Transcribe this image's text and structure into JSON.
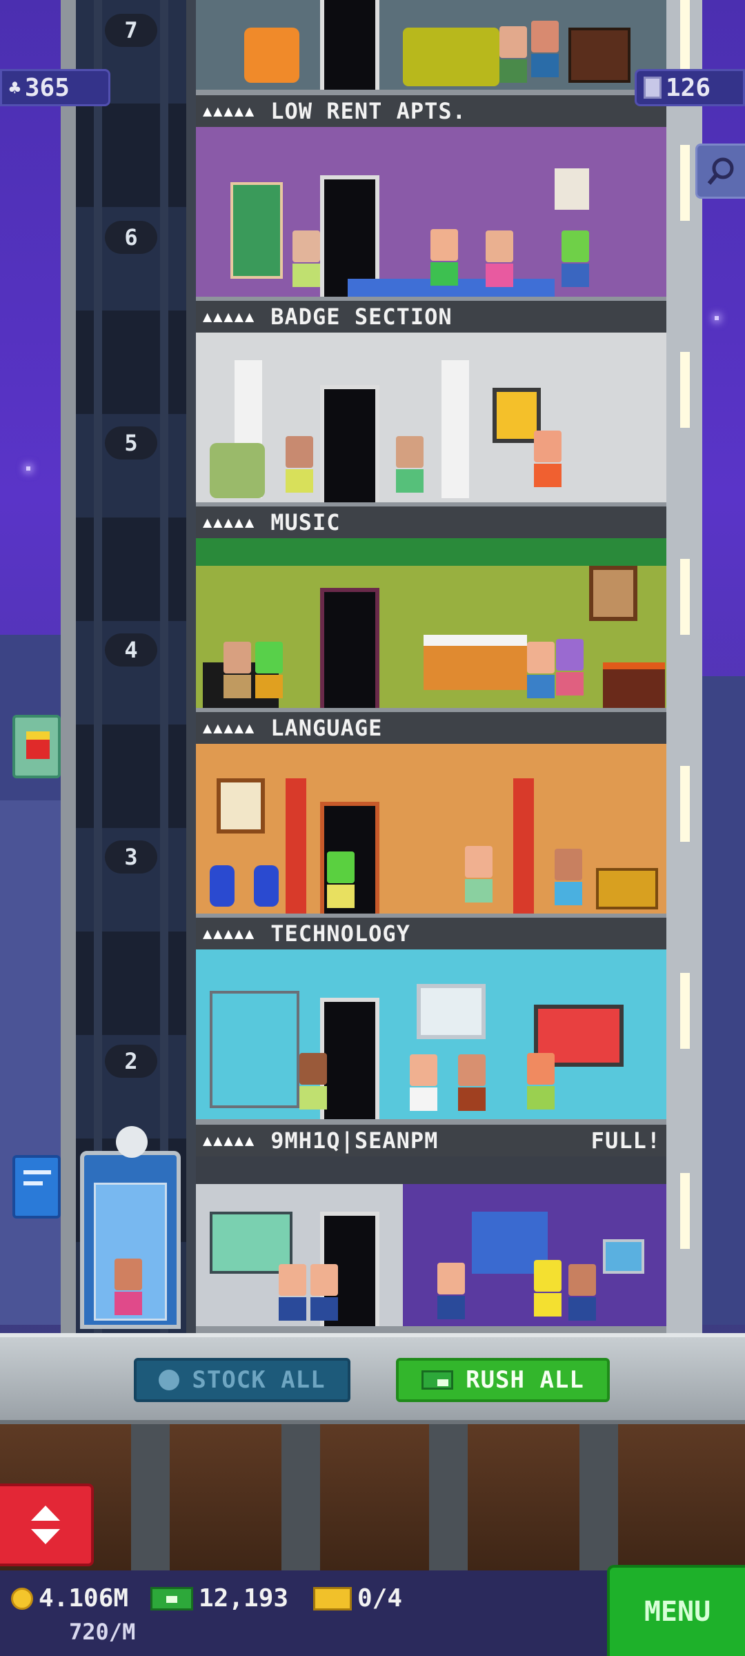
{
  "hud": {
    "population": "365",
    "floors_built": "126"
  },
  "floors": [
    {
      "number": "7",
      "label": "LOW RENT APTS.",
      "full": ""
    },
    {
      "number": "6",
      "label": "BADGE SECTION",
      "full": ""
    },
    {
      "number": "5",
      "label": "MUSIC",
      "full": ""
    },
    {
      "number": "4",
      "label": "LANGUAGE",
      "full": ""
    },
    {
      "number": "3",
      "label": "TECHNOLOGY",
      "full": ""
    },
    {
      "number": "2",
      "label": "9MH1Q|SEANPM",
      "full": "FULL!"
    }
  ],
  "floor_stars": "▲▲▲▲▲",
  "actions": {
    "stock_all": "STOCK ALL",
    "rush_all": "RUSH ALL"
  },
  "resources": {
    "coins": "4.106M",
    "tower_bux": "12,193",
    "tickets": "0/4",
    "coin_rate": "720/M"
  },
  "menu_label": "MENU",
  "colors": {
    "accent_green": "#33b62c",
    "stock_blue": "#1d5a7a",
    "elevator_red": "#e32736"
  }
}
